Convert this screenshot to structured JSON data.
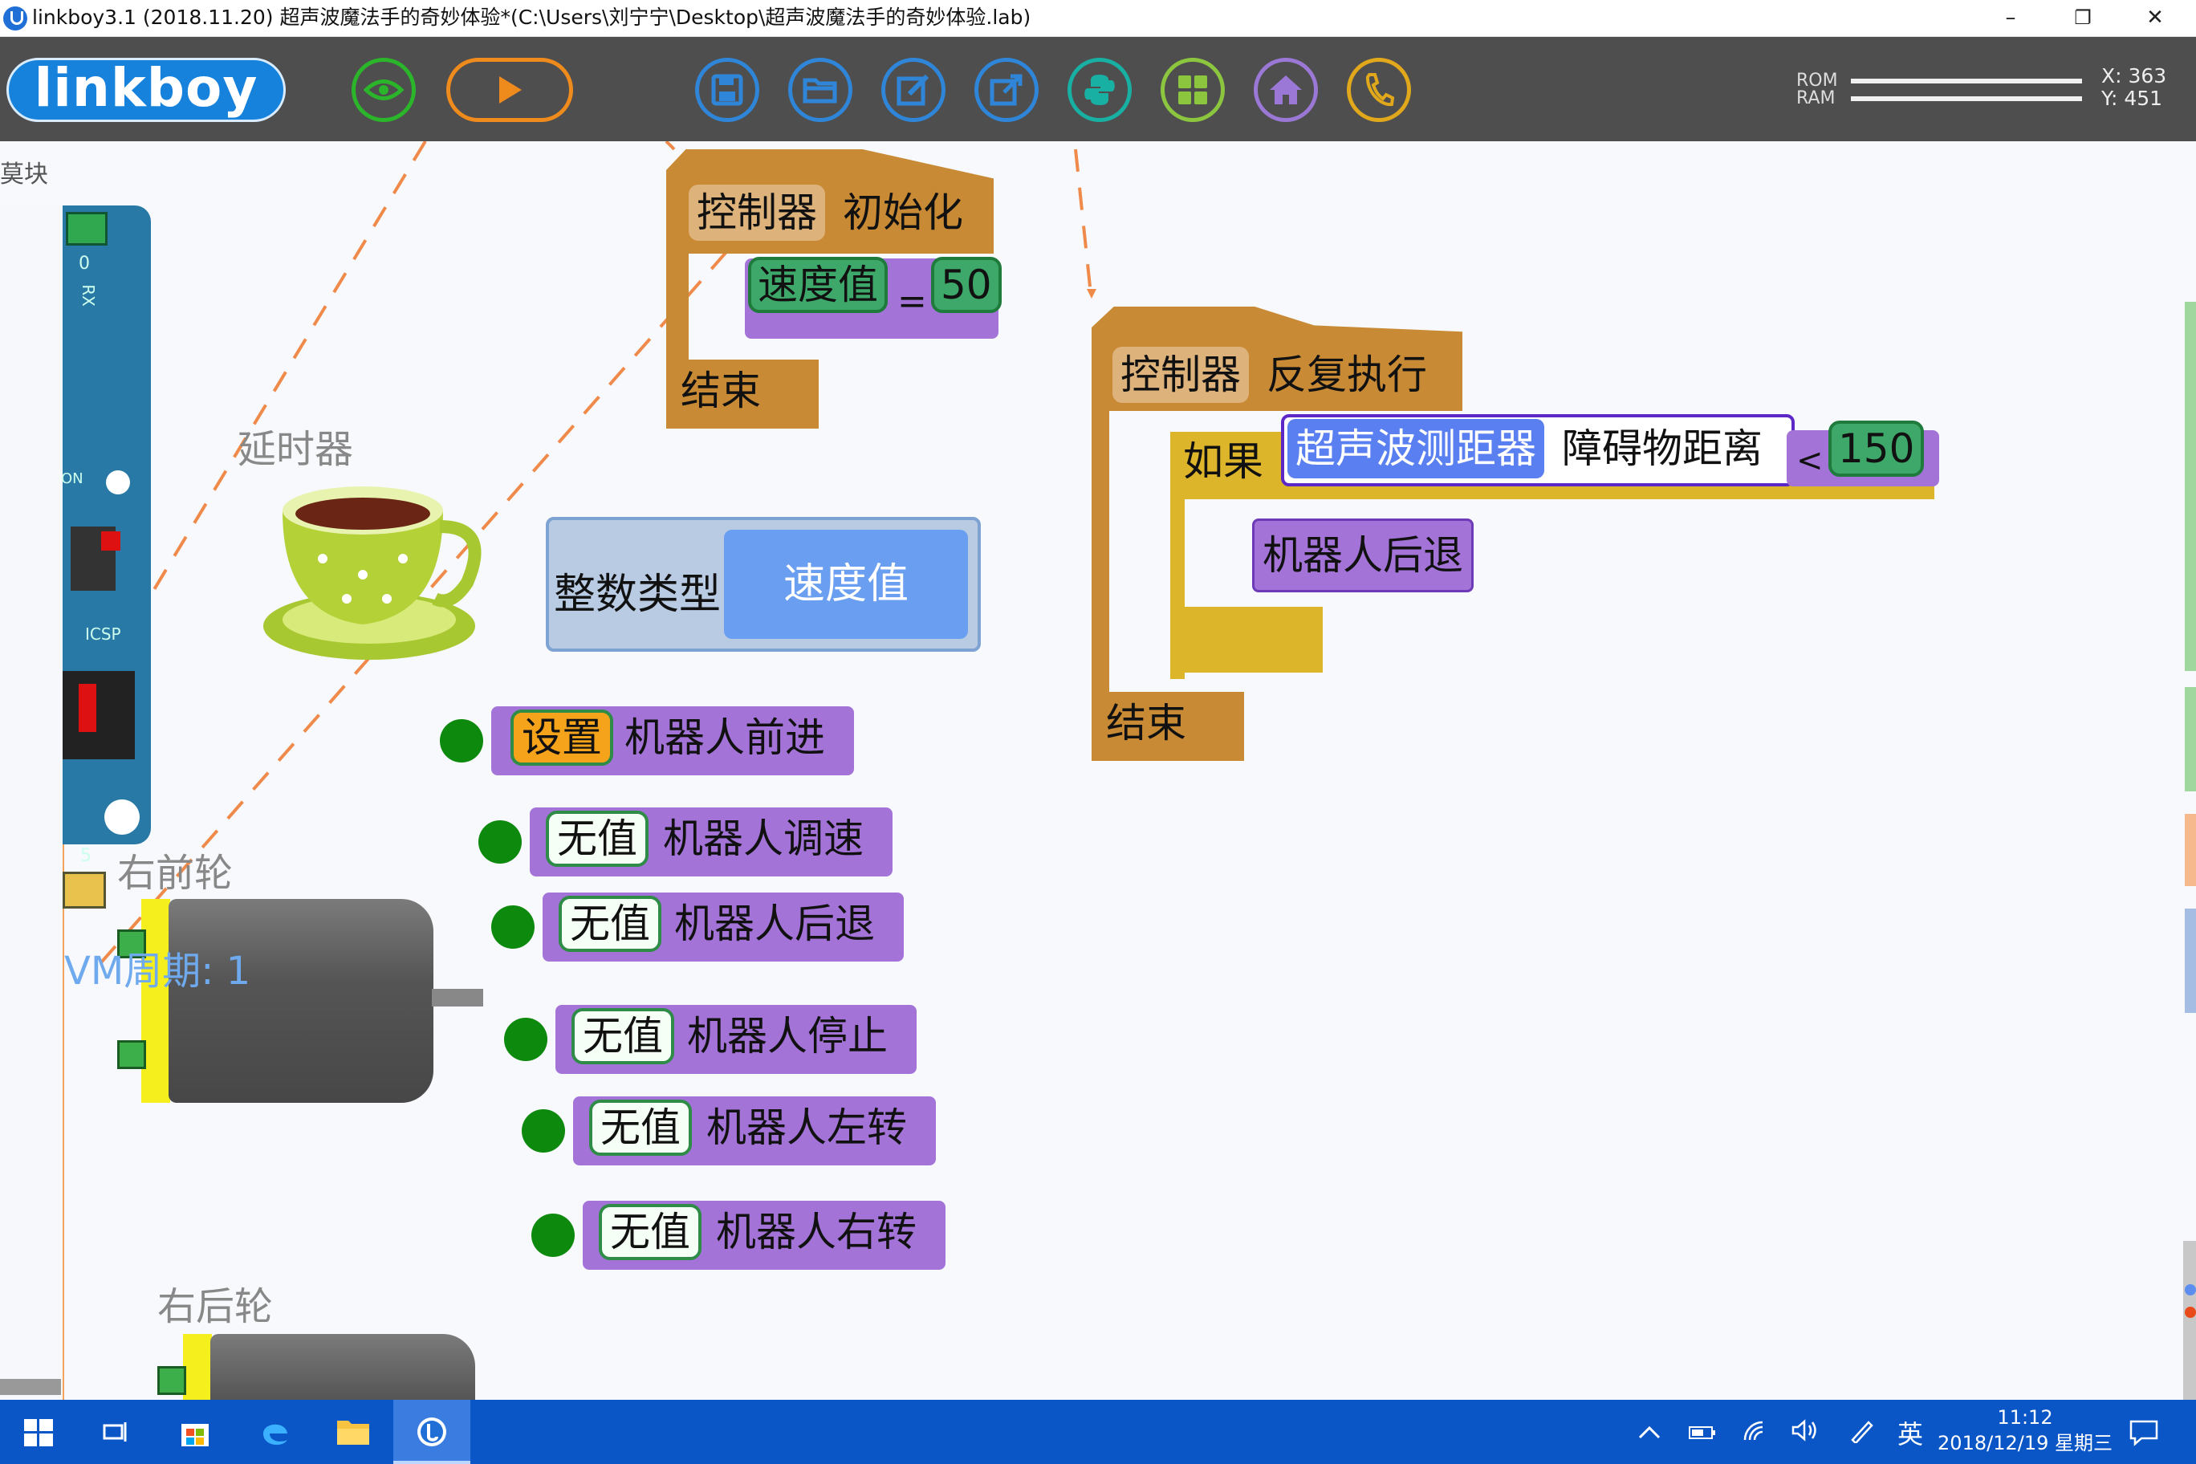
{
  "window": {
    "title": "linkboy3.1 (2018.11.20) 超声波魔法手的奇妙体验*(C:\\Users\\刘宁宁\\Desktop\\超声波魔法手的奇妙体验.lab)",
    "minimize_glyph": "–",
    "restore_glyph": "❐",
    "close_glyph": "✕"
  },
  "toolbar": {
    "logo": "linkboy",
    "icons": [
      "eye-icon",
      "play-icon",
      "save-icon",
      "open-folder-icon",
      "edit-icon",
      "export-icon",
      "python-icon",
      "grid-icon",
      "home-icon",
      "phone-icon"
    ],
    "rom_label": "ROM",
    "ram_label": "RAM",
    "rom_usage": 0.96,
    "ram_usage": 0.96,
    "x_readout": "X: 363",
    "y_readout": "Y: 451",
    "accent_colors": {
      "eye": "#2bb52b",
      "play": "#ef8a1c",
      "blue": "#2f86d8",
      "python": "#19b0a4",
      "grid": "#8cc63f",
      "home": "#9b78d6",
      "phone": "#e0a81a"
    }
  },
  "canvas": {
    "left_label": "莫块",
    "board_labels": [
      "0",
      "RX",
      "ON",
      "ICSP",
      "5"
    ],
    "components": {
      "timer_label": "延时器",
      "right_front_wheel": "右前轮",
      "right_rear_wheel": "右后轮",
      "pwm_text": "VM周期: 1"
    },
    "int_var": {
      "type_label": "整数类型",
      "name": "速度值"
    },
    "init_block": {
      "controller": "控制器",
      "action": "初始化",
      "var": "速度值",
      "op": "=",
      "value": "50",
      "end": "结束"
    },
    "loop_block": {
      "controller": "控制器",
      "action": "反复执行",
      "if": "如果",
      "sensor": "超声波测距器",
      "sensor_attr": "障碍物距离",
      "op": "<",
      "value": "150",
      "body": "机器人后退",
      "end": "结束"
    },
    "functions": [
      {
        "slot": "设置",
        "name": "机器人前进"
      },
      {
        "slot": "无值",
        "name": "机器人调速"
      },
      {
        "slot": "无值",
        "name": "机器人后退"
      },
      {
        "slot": "无值",
        "name": "机器人停止"
      },
      {
        "slot": "无值",
        "name": "机器人左转"
      },
      {
        "slot": "无值",
        "name": "机器人右转"
      }
    ]
  },
  "taskbar": {
    "ime": "英",
    "time": "11:12",
    "date": "2018/12/19 星期三"
  }
}
